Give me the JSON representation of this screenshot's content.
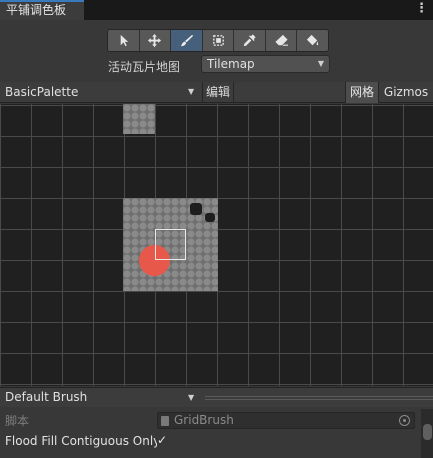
{
  "window": {
    "tab_title": "平铺调色板"
  },
  "tools": [
    {
      "name": "select-tool",
      "icon": "arrow-pointer-icon",
      "active": false
    },
    {
      "name": "move-tool",
      "icon": "move-icon",
      "active": false
    },
    {
      "name": "paint-tool",
      "icon": "brush-icon",
      "active": true
    },
    {
      "name": "box-fill-tool",
      "icon": "box-select-icon",
      "active": false
    },
    {
      "name": "pick-tool",
      "icon": "eyedropper-icon",
      "active": false
    },
    {
      "name": "erase-tool",
      "icon": "eraser-icon",
      "active": false
    },
    {
      "name": "fill-tool",
      "icon": "paint-bucket-icon",
      "active": false
    }
  ],
  "active_tilemap": {
    "label": "活动瓦片地图",
    "value": "Tilemap"
  },
  "palette_bar": {
    "palette_name": "BasicPalette",
    "edit_label": "编辑",
    "grid_label": "网格",
    "gizmos_label": "Gizmos"
  },
  "brush": {
    "name": "Default Brush",
    "script_label": "脚本",
    "script_value": "GridBrush",
    "flood_fill_label": "Flood Fill Contiguous Only",
    "flood_fill_checked": true,
    "check_glyph": "✓"
  },
  "colors": {
    "accent": "#3a79bb",
    "selected_tool": "#46607c",
    "scene_background": "#202020",
    "marker_red": "#e8584a"
  }
}
